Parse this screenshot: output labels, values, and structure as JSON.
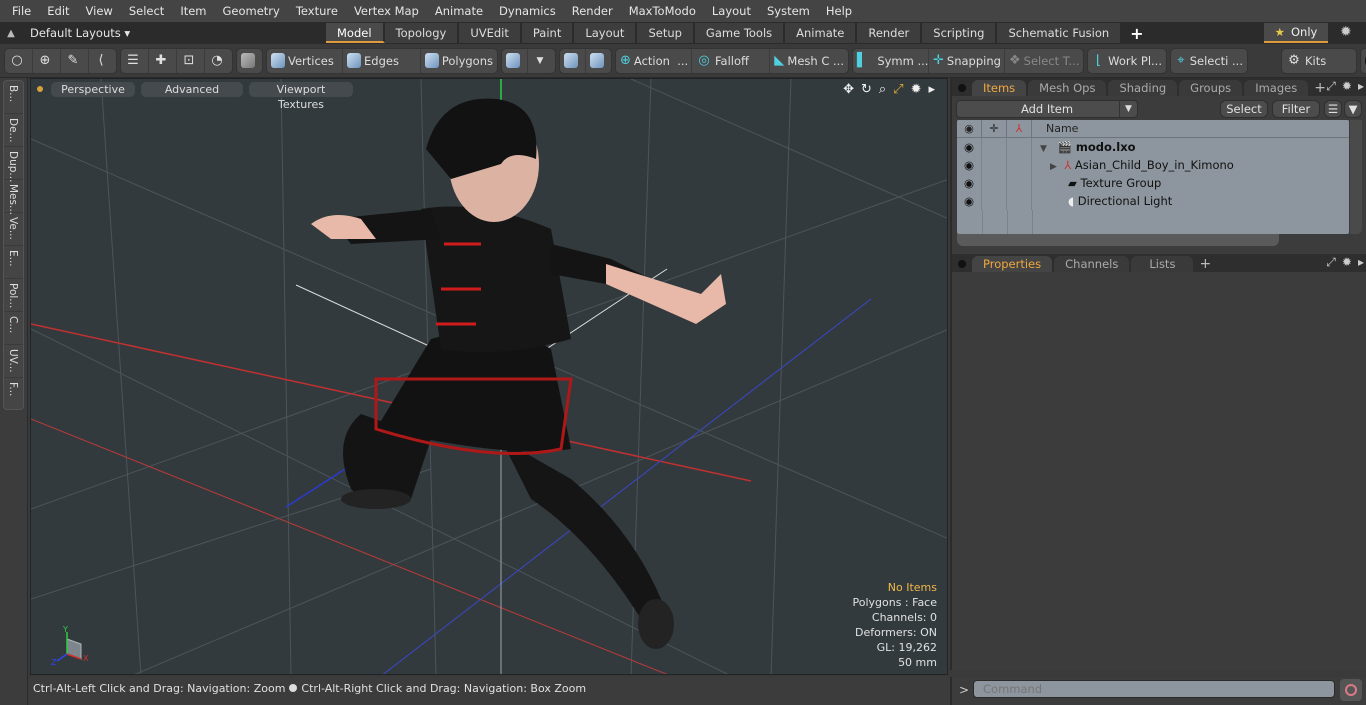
{
  "menu": [
    "File",
    "Edit",
    "View",
    "Select",
    "Item",
    "Geometry",
    "Texture",
    "Vertex Map",
    "Animate",
    "Dynamics",
    "Render",
    "MaxToModo",
    "Layout",
    "System",
    "Help"
  ],
  "layout_bar": {
    "layouts_label": "Default Layouts ▾",
    "tabs": [
      {
        "label": "Model",
        "active": true
      },
      {
        "label": "Topology"
      },
      {
        "label": "UVEdit"
      },
      {
        "label": "Paint"
      },
      {
        "label": "Layout"
      },
      {
        "label": "Setup"
      },
      {
        "label": "Game Tools"
      },
      {
        "label": "Animate"
      },
      {
        "label": "Render"
      },
      {
        "label": "Scripting"
      },
      {
        "label": "Schematic Fusion"
      }
    ],
    "add_tab": "+",
    "only_label": "Only",
    "only_icon": "★"
  },
  "toolbar": {
    "vertices": "Vertices",
    "edges": "Edges",
    "polygons": "Polygons",
    "action": "Action",
    "action_more": "...",
    "falloff": "Falloff",
    "mesh_c": "Mesh C ...",
    "symm": "Symm ...",
    "snapping": "Snapping",
    "select_t": "Select T...",
    "work_pl": "Work Pl...",
    "selecti": "Selecti ...",
    "kits": "Kits"
  },
  "left_tabs": [
    "B...",
    "De...",
    "Dup...",
    "Mes...",
    "Ve...",
    "E...",
    "Pol...",
    "C...",
    "UV...",
    "F..."
  ],
  "viewport": {
    "perspective": "Perspective",
    "advanced": "Advanced",
    "viewport_textures": "Viewport Textures",
    "info": {
      "items": "No Items",
      "polygons": "Polygons : Face",
      "channels": "Channels: 0",
      "deformers": "Deformers: ON",
      "gl": "GL: 19,262",
      "units": "50 mm"
    },
    "axis_labels": {
      "x": "X",
      "y": "Y",
      "z": "Z"
    }
  },
  "status_bar": {
    "hint_left": "Ctrl-Alt-Left Click and Drag: Navigation: Zoom",
    "hint_right": "Ctrl-Alt-Right Click and Drag: Navigation: Box Zoom"
  },
  "items_panel": {
    "tabs": [
      {
        "label": "Items",
        "active": true
      },
      {
        "label": "Mesh Ops"
      },
      {
        "label": "Shading"
      },
      {
        "label": "Groups"
      },
      {
        "label": "Images"
      }
    ],
    "add_item": "Add Item",
    "select": "Select",
    "filter": "Filter",
    "column_name": "Name",
    "rows": [
      {
        "name": "modo.lxo",
        "icon": "scene-icon",
        "bold": true,
        "expander": "▼"
      },
      {
        "name": "Asian_Child_Boy_in_Kimono",
        "icon": "mesh-locator-icon",
        "expander": "▶"
      },
      {
        "name": "Texture Group",
        "icon": "folder-icon"
      },
      {
        "name": "Directional Light",
        "icon": "light-icon"
      }
    ]
  },
  "properties_panel": {
    "tabs": [
      {
        "label": "Properties",
        "active": true
      },
      {
        "label": "Channels"
      },
      {
        "label": "Lists"
      }
    ]
  },
  "command": {
    "prompt": ">",
    "placeholder": "Command"
  },
  "colors": {
    "accent": "#e09b3d",
    "viewport_bg": "#323a3e",
    "info_highlight": "#f0b84a"
  }
}
